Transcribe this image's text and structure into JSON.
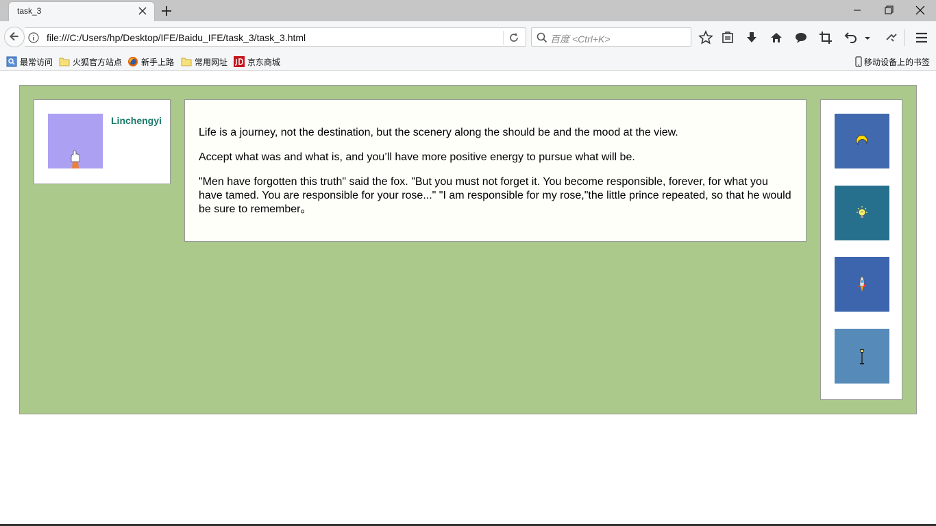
{
  "browser": {
    "tab_title": "task_3",
    "url": "file:///C:/Users/hp/Desktop/IFE/Baidu_IFE/task_3/task_3.html",
    "search_placeholder": "百度 <Ctrl+K>",
    "toolbar_icons": [
      "star-icon",
      "reading-list-icon",
      "download-icon",
      "home-icon",
      "chat-icon",
      "crop-icon",
      "undo-icon",
      "dropdown-icon",
      "extension-icon",
      "menu-icon"
    ]
  },
  "bookmarks": {
    "items": [
      {
        "label": "最常访问",
        "icon": "most-visited-icon"
      },
      {
        "label": "火狐官方站点",
        "icon": "folder-icon"
      },
      {
        "label": "新手上路",
        "icon": "firefox-icon"
      },
      {
        "label": "常用网址",
        "icon": "folder-icon"
      },
      {
        "label": "京东商城",
        "icon": "jd-icon"
      }
    ],
    "mobile_label": "移动设备上的书签"
  },
  "page": {
    "username": "Linchengyi",
    "paragraphs": [
      "Life is a journey, not the destination, but the scenery along the should be and the mood at the view.",
      "Accept what was and what is, and you’ll have more positive energy to pursue what will be.",
      "\"Men have forgotten this truth\" said the fox. \"But you must not forget it. You become responsible, forever, for what you have tamed. You are responsible for your rose...\" \"I am responsible for my rose,\"the little prince repeated, so that he would be sure to remember。"
    ],
    "tiles": [
      {
        "icon": "moon-icon",
        "color": "#4169ae"
      },
      {
        "icon": "lightbulb-icon",
        "color": "#26708e"
      },
      {
        "icon": "rocket-icon",
        "color": "#3c65ad"
      },
      {
        "icon": "street-lamp-icon",
        "color": "#568ab8"
      }
    ],
    "colors": {
      "background": "#aac98b",
      "avatar": "#aca0f2",
      "username": "#1b7a6a"
    }
  }
}
